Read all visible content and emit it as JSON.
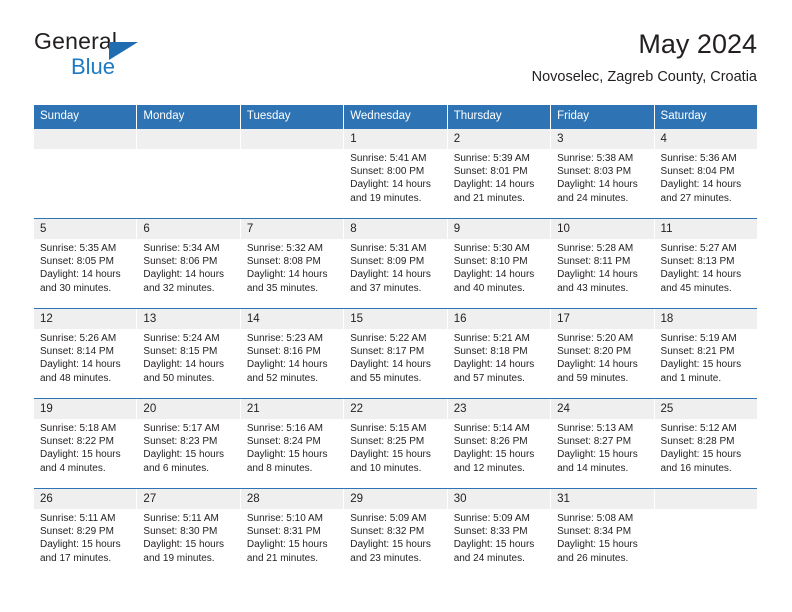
{
  "brand": {
    "name_part1": "General",
    "name_part2": "Blue",
    "triangle_color": "#1f6cb0",
    "blue_color": "#1f7ac4"
  },
  "header": {
    "title": "May 2024",
    "subtitle": "Novoselec, Zagreb County, Croatia"
  },
  "colors": {
    "header_blue": "#2e74b5",
    "day_band_gray": "#efefef",
    "text": "#231f20"
  },
  "weekdays": [
    "Sunday",
    "Monday",
    "Tuesday",
    "Wednesday",
    "Thursday",
    "Friday",
    "Saturday"
  ],
  "weeks": [
    [
      {
        "day": "",
        "sunrise": "",
        "sunset": "",
        "daylight": "",
        "empty": true
      },
      {
        "day": "",
        "sunrise": "",
        "sunset": "",
        "daylight": "",
        "empty": true
      },
      {
        "day": "",
        "sunrise": "",
        "sunset": "",
        "daylight": "",
        "empty": true
      },
      {
        "day": "1",
        "sunrise": "Sunrise: 5:41 AM",
        "sunset": "Sunset: 8:00 PM",
        "daylight": "Daylight: 14 hours and 19 minutes."
      },
      {
        "day": "2",
        "sunrise": "Sunrise: 5:39 AM",
        "sunset": "Sunset: 8:01 PM",
        "daylight": "Daylight: 14 hours and 21 minutes."
      },
      {
        "day": "3",
        "sunrise": "Sunrise: 5:38 AM",
        "sunset": "Sunset: 8:03 PM",
        "daylight": "Daylight: 14 hours and 24 minutes."
      },
      {
        "day": "4",
        "sunrise": "Sunrise: 5:36 AM",
        "sunset": "Sunset: 8:04 PM",
        "daylight": "Daylight: 14 hours and 27 minutes."
      }
    ],
    [
      {
        "day": "5",
        "sunrise": "Sunrise: 5:35 AM",
        "sunset": "Sunset: 8:05 PM",
        "daylight": "Daylight: 14 hours and 30 minutes."
      },
      {
        "day": "6",
        "sunrise": "Sunrise: 5:34 AM",
        "sunset": "Sunset: 8:06 PM",
        "daylight": "Daylight: 14 hours and 32 minutes."
      },
      {
        "day": "7",
        "sunrise": "Sunrise: 5:32 AM",
        "sunset": "Sunset: 8:08 PM",
        "daylight": "Daylight: 14 hours and 35 minutes."
      },
      {
        "day": "8",
        "sunrise": "Sunrise: 5:31 AM",
        "sunset": "Sunset: 8:09 PM",
        "daylight": "Daylight: 14 hours and 37 minutes."
      },
      {
        "day": "9",
        "sunrise": "Sunrise: 5:30 AM",
        "sunset": "Sunset: 8:10 PM",
        "daylight": "Daylight: 14 hours and 40 minutes."
      },
      {
        "day": "10",
        "sunrise": "Sunrise: 5:28 AM",
        "sunset": "Sunset: 8:11 PM",
        "daylight": "Daylight: 14 hours and 43 minutes."
      },
      {
        "day": "11",
        "sunrise": "Sunrise: 5:27 AM",
        "sunset": "Sunset: 8:13 PM",
        "daylight": "Daylight: 14 hours and 45 minutes."
      }
    ],
    [
      {
        "day": "12",
        "sunrise": "Sunrise: 5:26 AM",
        "sunset": "Sunset: 8:14 PM",
        "daylight": "Daylight: 14 hours and 48 minutes."
      },
      {
        "day": "13",
        "sunrise": "Sunrise: 5:24 AM",
        "sunset": "Sunset: 8:15 PM",
        "daylight": "Daylight: 14 hours and 50 minutes."
      },
      {
        "day": "14",
        "sunrise": "Sunrise: 5:23 AM",
        "sunset": "Sunset: 8:16 PM",
        "daylight": "Daylight: 14 hours and 52 minutes."
      },
      {
        "day": "15",
        "sunrise": "Sunrise: 5:22 AM",
        "sunset": "Sunset: 8:17 PM",
        "daylight": "Daylight: 14 hours and 55 minutes."
      },
      {
        "day": "16",
        "sunrise": "Sunrise: 5:21 AM",
        "sunset": "Sunset: 8:18 PM",
        "daylight": "Daylight: 14 hours and 57 minutes."
      },
      {
        "day": "17",
        "sunrise": "Sunrise: 5:20 AM",
        "sunset": "Sunset: 8:20 PM",
        "daylight": "Daylight: 14 hours and 59 minutes."
      },
      {
        "day": "18",
        "sunrise": "Sunrise: 5:19 AM",
        "sunset": "Sunset: 8:21 PM",
        "daylight": "Daylight: 15 hours and 1 minute."
      }
    ],
    [
      {
        "day": "19",
        "sunrise": "Sunrise: 5:18 AM",
        "sunset": "Sunset: 8:22 PM",
        "daylight": "Daylight: 15 hours and 4 minutes."
      },
      {
        "day": "20",
        "sunrise": "Sunrise: 5:17 AM",
        "sunset": "Sunset: 8:23 PM",
        "daylight": "Daylight: 15 hours and 6 minutes."
      },
      {
        "day": "21",
        "sunrise": "Sunrise: 5:16 AM",
        "sunset": "Sunset: 8:24 PM",
        "daylight": "Daylight: 15 hours and 8 minutes."
      },
      {
        "day": "22",
        "sunrise": "Sunrise: 5:15 AM",
        "sunset": "Sunset: 8:25 PM",
        "daylight": "Daylight: 15 hours and 10 minutes."
      },
      {
        "day": "23",
        "sunrise": "Sunrise: 5:14 AM",
        "sunset": "Sunset: 8:26 PM",
        "daylight": "Daylight: 15 hours and 12 minutes."
      },
      {
        "day": "24",
        "sunrise": "Sunrise: 5:13 AM",
        "sunset": "Sunset: 8:27 PM",
        "daylight": "Daylight: 15 hours and 14 minutes."
      },
      {
        "day": "25",
        "sunrise": "Sunrise: 5:12 AM",
        "sunset": "Sunset: 8:28 PM",
        "daylight": "Daylight: 15 hours and 16 minutes."
      }
    ],
    [
      {
        "day": "26",
        "sunrise": "Sunrise: 5:11 AM",
        "sunset": "Sunset: 8:29 PM",
        "daylight": "Daylight: 15 hours and 17 minutes."
      },
      {
        "day": "27",
        "sunrise": "Sunrise: 5:11 AM",
        "sunset": "Sunset: 8:30 PM",
        "daylight": "Daylight: 15 hours and 19 minutes."
      },
      {
        "day": "28",
        "sunrise": "Sunrise: 5:10 AM",
        "sunset": "Sunset: 8:31 PM",
        "daylight": "Daylight: 15 hours and 21 minutes."
      },
      {
        "day": "29",
        "sunrise": "Sunrise: 5:09 AM",
        "sunset": "Sunset: 8:32 PM",
        "daylight": "Daylight: 15 hours and 23 minutes."
      },
      {
        "day": "30",
        "sunrise": "Sunrise: 5:09 AM",
        "sunset": "Sunset: 8:33 PM",
        "daylight": "Daylight: 15 hours and 24 minutes."
      },
      {
        "day": "31",
        "sunrise": "Sunrise: 5:08 AM",
        "sunset": "Sunset: 8:34 PM",
        "daylight": "Daylight: 15 hours and 26 minutes."
      },
      {
        "day": "",
        "sunrise": "",
        "sunset": "",
        "daylight": "",
        "empty": true
      }
    ]
  ]
}
